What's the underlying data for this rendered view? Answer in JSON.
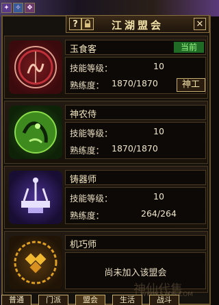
{
  "window": {
    "title": "江湖盟会",
    "help_label": "?",
    "close_label": "✕"
  },
  "top_icons": [
    {
      "icon": "buff-icon-1",
      "glyph": "✦"
    },
    {
      "icon": "buff-icon-2",
      "glyph": "✧"
    },
    {
      "icon": "buff-icon-3",
      "glyph": "❖"
    }
  ],
  "labels": {
    "skill_level": "技能等级：",
    "proficiency": "熟练度："
  },
  "guilds": [
    {
      "name": "玉食客",
      "skill_level": "10",
      "proficiency": "1870/1870",
      "status": "当前",
      "action": "神工",
      "emblem": "jade-chef-emblem-icon",
      "color": "#c0303a"
    },
    {
      "name": "神农侍",
      "skill_level": "10",
      "proficiency": "1870/1870",
      "emblem": "shennong-emblem-icon",
      "color": "#5fbf2a"
    },
    {
      "name": "铸器师",
      "skill_level": "10",
      "proficiency": "264/264",
      "emblem": "forge-emblem-icon",
      "color": "#7a5ad0"
    },
    {
      "name": "机巧师",
      "not_joined": "尚未加入该盟会",
      "emblem": "mechanic-emblem-icon",
      "color": "#e0a020"
    }
  ],
  "tabs": [
    "普通",
    "门派",
    "盟会",
    "生活",
    "战斗"
  ],
  "watermark": {
    "text": "神仙代售",
    "url": "WWW.SXDS.COM"
  }
}
